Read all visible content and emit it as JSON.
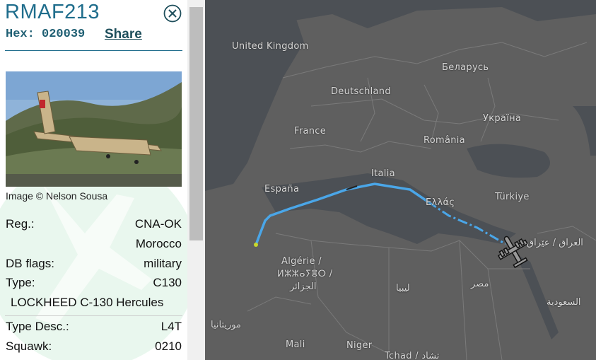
{
  "aircraft": {
    "callsign": "RMAF213",
    "hex_label": "Hex:",
    "hex": "020039",
    "share_label": "Share"
  },
  "photo": {
    "credit": "Image © Nelson Sousa"
  },
  "details": {
    "reg_label": "Reg.:",
    "reg": "CNA-OK",
    "country": "Morocco",
    "dbflags_label": "DB flags:",
    "dbflags": "military",
    "type_label": "Type:",
    "type": "C130",
    "type_full": "LOCKHEED C-130 Hercules",
    "typedesc_label": "Type Desc.:",
    "typedesc": "L4T",
    "squawk_label": "Squawk:",
    "squawk": "0210"
  },
  "map": {
    "labels": {
      "uk": "United Kingdom",
      "belarus": "Беларусь",
      "germany": "Deutschland",
      "ukraine": "Україна",
      "france": "France",
      "romania": "România",
      "spain": "España",
      "italy": "Italia",
      "turkey": "Türkiye",
      "greece": "Ελλάς",
      "iraq": "العراق / عێراق",
      "algeria1": "Algérie /",
      "algeria2": "ⵍⵣⵣⴰⵢⴻⵔ /",
      "algeria3": "الجزائر",
      "libya": "ليبيا",
      "egypt": "مصر",
      "saudi": "السعودية",
      "mauritania": "موريتانيا",
      "mali": "Mali",
      "niger": "Niger",
      "chad": "Tchad / تشاد"
    }
  },
  "colors": {
    "accent": "#1f6d8c",
    "track": "#4aa6e8",
    "map_land": "#5f5f5f",
    "map_sea": "#4a4e52"
  }
}
